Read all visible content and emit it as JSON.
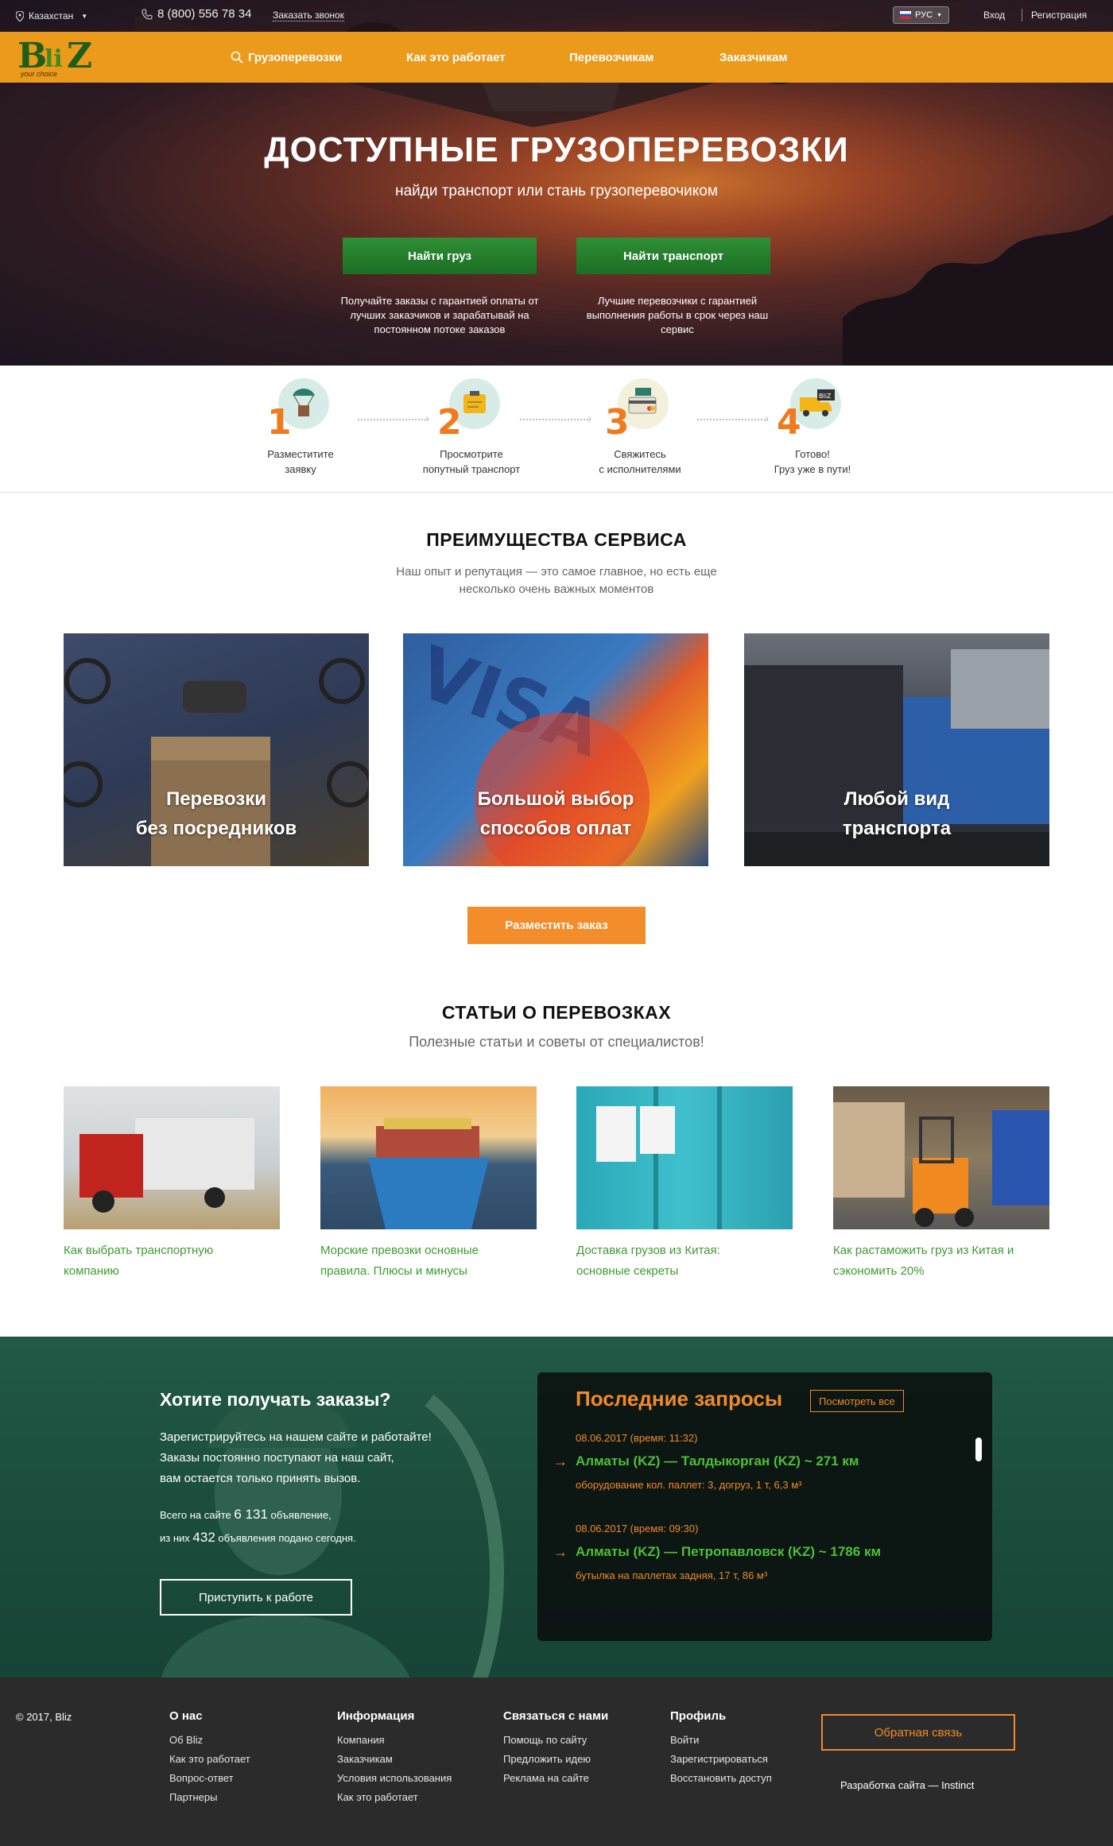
{
  "topbar": {
    "location": "Казахстан",
    "phone": "8 (800) 556 78 34",
    "callback": "Заказать звонок",
    "language": "РУС",
    "login": "Вход",
    "register": "Регистрация"
  },
  "logo": {
    "b": "B",
    "li": "li",
    "z": "Z",
    "tagline": "your choice"
  },
  "nav": [
    "Грузоперевозки",
    "Как это работает",
    "Перевозчикам",
    "Заказчикам"
  ],
  "hero": {
    "title": "ДОСТУПНЫЕ ГРУЗОПЕРЕВОЗКИ",
    "subtitle": "найди транспорт или стань грузоперевочиком",
    "btn_cargo": "Найти груз",
    "btn_transport": "Найти транспорт",
    "desc_cargo": "Получайте заказы с гарантией оплаты от лучших заказчиков и зарабатывай на постоянном потоке заказов",
    "desc_transport": "Лучшие перевозчики с гарантией выполнения работы в срок через наш сервис"
  },
  "steps": [
    {
      "num": "1",
      "line1": "Разместитите",
      "line2": "заявку"
    },
    {
      "num": "2",
      "line1": "Просмотрите",
      "line2": "попутный транспорт"
    },
    {
      "num": "3",
      "line1": "Свяжитесь",
      "line2": "с исполнителями"
    },
    {
      "num": "4",
      "line1": "Готово!",
      "line2": "Груз уже в пути!"
    }
  ],
  "advantages": {
    "title": "ПРЕИМУЩЕСТВА СЕРВИСА",
    "sub1": "Наш опыт и репутация — это самое главное, но есть еще",
    "sub2": "несколько очень важных моментов",
    "cards": [
      {
        "l1": "Перевозки",
        "l2": "без посредников"
      },
      {
        "l1": "Большой выбор",
        "l2": "способов оплат"
      },
      {
        "l1": "Любой вид",
        "l2": "транспорта"
      }
    ],
    "button": "Разместить заказ"
  },
  "articles": {
    "title": "СТАТЬИ О ПЕРЕВОЗКАХ",
    "sub": "Полезные статьи и советы от специалистов!",
    "items": [
      {
        "l1": "Как выбрать транспортную",
        "l2": "компанию"
      },
      {
        "l1": "Морские превозки основные",
        "l2": "правила. Плюсы и минусы"
      },
      {
        "l1": "Доставка грузов из Китая:",
        "l2": "основные секреты"
      },
      {
        "l1": "Как растаможить груз из Китая и",
        "l2": "сэкономить 20%"
      }
    ]
  },
  "cta": {
    "title": "Хотите получать заказы?",
    "p1": "Зарегистрируйтесь на нашем сайте и работайте!",
    "p2": "Заказы постоянно поступают на наш сайт,",
    "p3": "вам остается только принять вызов.",
    "stat1_pre": "Всего на сайте",
    "stat1_num": "6 131",
    "stat1_post": "объявление,",
    "stat2_pre": "из них",
    "stat2_num": "432",
    "stat2_post": "объявления подано сегодня.",
    "button": "Приступить к работе"
  },
  "requests": {
    "title": "Последние запросы",
    "view_all": "Посмотреть все",
    "items": [
      {
        "date": "08.06.2017 (время: 11:32)",
        "route": "Алматы (KZ) — Талдыкорган (KZ)  ~ 271 км",
        "cargo": "оборудование кол. паллет: 3, догруз, 1 т, 6,3 м³"
      },
      {
        "date": "08.06.2017 (время: 09:30)",
        "route": "Алматы (KZ) — Петропавловск (KZ) ~ 1786 км",
        "cargo": "бутылка на паллетах задняя, 17 т, 86 м³"
      }
    ]
  },
  "footer": {
    "copyright": "© 2017, Bliz",
    "cols": [
      {
        "head": "О нас",
        "links": [
          "Об Bliz",
          "Как это работает",
          "Вопрос-ответ",
          "Партнеры"
        ]
      },
      {
        "head": "Информация",
        "links": [
          "Компания",
          "Заказчикам",
          "Условия использования",
          "Как это работает"
        ]
      },
      {
        "head": "Связаться с нами",
        "links": [
          "Помощь по сайту",
          "Предложить идею",
          "Реклама на сайте"
        ]
      },
      {
        "head": "Профиль",
        "links": [
          "Войти",
          "Зарегистрироваться",
          "Восстановить доступ"
        ]
      }
    ],
    "feedback": "Обратная связь",
    "dev": "Разработка сайта — Instinct"
  },
  "icons": {
    "location": "map-pin-icon",
    "phone": "phone-icon",
    "search": "search-icon",
    "flag": "russia-flag-icon",
    "arrow": "arrow-right-icon"
  },
  "colors": {
    "nav_orange": "#ec9a1c",
    "green_button": "#1c6e23",
    "accent_orange": "#f38d2c",
    "link_green": "#3c9b2f",
    "footer_bg": "#2b2b2b"
  }
}
